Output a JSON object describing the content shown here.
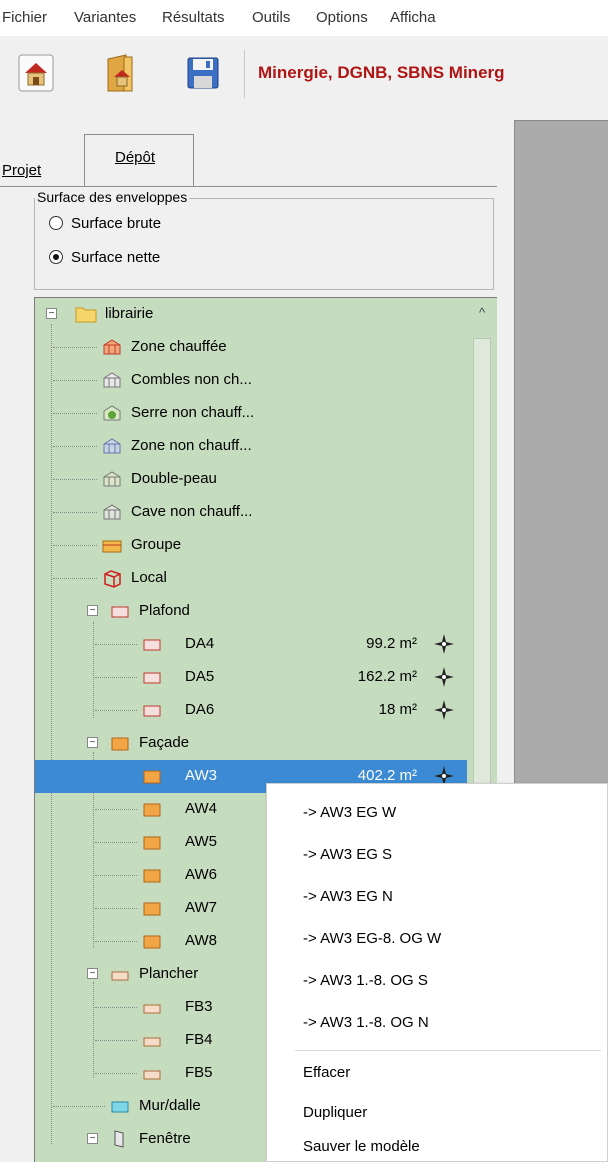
{
  "menu": {
    "items": [
      "Fichier",
      "Variantes",
      "Résultats",
      "Outils",
      "Options",
      "Afficha"
    ]
  },
  "toolbar": {
    "title": "Minergie, DGNB, SBNS Minerg",
    "buttons": [
      "house-icon",
      "open-folder-icon",
      "save-icon"
    ],
    "title_color": "#b01515"
  },
  "tabs": [
    {
      "label": "Projet",
      "selected": false
    },
    {
      "label": "Dépôt",
      "selected": true
    }
  ],
  "envelope": {
    "legend": "Surface des enveloppes",
    "options": [
      {
        "label": "Surface brute",
        "selected": false
      },
      {
        "label": "Surface nette",
        "selected": true
      }
    ]
  },
  "tree": {
    "root": "librairie",
    "items": [
      {
        "label": "Zone chauffée",
        "icon": "heated-zone-icon"
      },
      {
        "label": "Combles non ch...",
        "icon": "attic-icon"
      },
      {
        "label": "Serre non chauff...",
        "icon": "greenhouse-icon"
      },
      {
        "label": "Zone non chauff...",
        "icon": "unheated-zone-icon"
      },
      {
        "label": "Double-peau",
        "icon": "double-skin-icon"
      },
      {
        "label": "Cave non chauff...",
        "icon": "cellar-icon"
      },
      {
        "label": "Groupe",
        "icon": "group-icon"
      },
      {
        "label": "Local",
        "icon": "local-icon"
      },
      {
        "label": "Plafond",
        "icon": "ceiling-icon"
      },
      {
        "label": "DA4",
        "area": "99.2 m²",
        "icon": "ceiling-element-icon"
      },
      {
        "label": "DA5",
        "area": "162.2 m²",
        "icon": "ceiling-element-icon"
      },
      {
        "label": "DA6",
        "area": "18 m²",
        "icon": "ceiling-element-icon"
      },
      {
        "label": "Façade",
        "icon": "facade-icon"
      },
      {
        "label": "AW3",
        "area": "402.2 m²",
        "icon": "facade-element-icon",
        "selected": true
      },
      {
        "label": "AW4",
        "icon": "facade-element-icon"
      },
      {
        "label": "AW5",
        "icon": "facade-element-icon"
      },
      {
        "label": "AW6",
        "icon": "facade-element-icon"
      },
      {
        "label": "AW7",
        "icon": "facade-element-icon"
      },
      {
        "label": "AW8",
        "icon": "facade-element-icon"
      },
      {
        "label": "Plancher",
        "icon": "floor-icon"
      },
      {
        "label": "FB3",
        "icon": "floor-element-icon"
      },
      {
        "label": "FB4",
        "icon": "floor-element-icon"
      },
      {
        "label": "FB5",
        "icon": "floor-element-icon"
      },
      {
        "label": "Mur/dalle",
        "icon": "wall-slab-icon"
      },
      {
        "label": "Fenêtre",
        "icon": "window-icon"
      }
    ]
  },
  "context_menu": {
    "items": [
      "-> AW3 EG W",
      "-> AW3 EG S",
      "-> AW3 EG N",
      "-> AW3 EG-8. OG W",
      "-> AW3 1.-8. OG S",
      "-> AW3 1.-8. OG N",
      "Effacer",
      "Dupliquer",
      "Sauver le modèle"
    ]
  },
  "colors": {
    "tree_background": "#c6dcbf",
    "selection": "#3b8ad3",
    "canvas_grey": "#ababab"
  }
}
